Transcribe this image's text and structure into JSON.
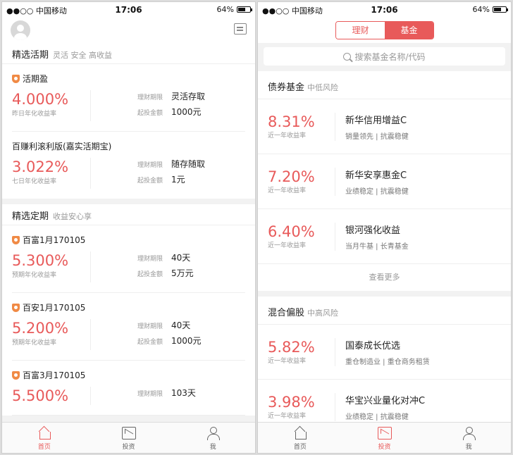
{
  "left": {
    "status": {
      "carrier": "●●○○ 中国移动",
      "time": "17:06",
      "battery": "64%",
      "battery_level": 0.64
    },
    "section1": {
      "title": "精选活期",
      "subtitle": "灵活 安全 高收益",
      "products": [
        {
          "name": "活期盈",
          "rate": "4.000%",
          "rate_label": "昨日年化收益率",
          "term_label": "理财期限",
          "term_value": "灵活存取",
          "min_label": "起投金额",
          "min_value": "1000元"
        },
        {
          "name": "百赚利滚利版(嘉实活期宝)",
          "rate": "3.022%",
          "rate_label": "七日年化收益率",
          "term_label": "理财期限",
          "term_value": "随存随取",
          "min_label": "起投金额",
          "min_value": "1元"
        }
      ]
    },
    "section2": {
      "title": "精选定期",
      "subtitle": "收益安心享",
      "products": [
        {
          "name": "百富1月170105",
          "rate": "5.300%",
          "rate_label": "预期年化收益率",
          "term_label": "理财期限",
          "term_value": "40天",
          "min_label": "起投金额",
          "min_value": "5万元"
        },
        {
          "name": "百安1月170105",
          "rate": "5.200%",
          "rate_label": "预期年化收益率",
          "term_label": "理财期限",
          "term_value": "40天",
          "min_label": "起投金额",
          "min_value": "1000元"
        },
        {
          "name": "百富3月170105",
          "rate": "5.500%",
          "term_label": "理财期限",
          "term_value": "103天"
        }
      ]
    },
    "tabs": [
      "首页",
      "投资",
      "我"
    ]
  },
  "right": {
    "status": {
      "carrier": "●●○○ 中国移动",
      "time": "17:06",
      "battery": "64%",
      "battery_level": 0.64
    },
    "segment": [
      "理财",
      "基金"
    ],
    "search_placeholder": "搜索基金名称/代码",
    "bond": {
      "title": "债券基金",
      "subtitle": "中低风险",
      "funds": [
        {
          "rate": "8.31%",
          "rate_label": "近一年收益率",
          "name": "新华信用增益C",
          "tags": "销量领先 | 抗震稳健"
        },
        {
          "rate": "7.20%",
          "rate_label": "近一年收益率",
          "name": "新华安享惠金C",
          "tags": "业绩稳定 | 抗震稳健"
        },
        {
          "rate": "6.40%",
          "rate_label": "近一年收益率",
          "name": "银河强化收益",
          "tags": "当月牛基 | 长青基金"
        }
      ],
      "more": "查看更多"
    },
    "mixed": {
      "title": "混合偏股",
      "subtitle": "中高风险",
      "funds": [
        {
          "rate": "5.82%",
          "rate_label": "近一年收益率",
          "name": "国泰成长优选",
          "tags": "重仓制造业 | 重仓商务租赁"
        },
        {
          "rate": "3.98%",
          "rate_label": "近一年收益率",
          "name": "华宝兴业量化对冲C",
          "tags": "业绩稳定 | 抗震稳健"
        }
      ]
    },
    "tabs": [
      "首页",
      "投资",
      "我"
    ]
  }
}
